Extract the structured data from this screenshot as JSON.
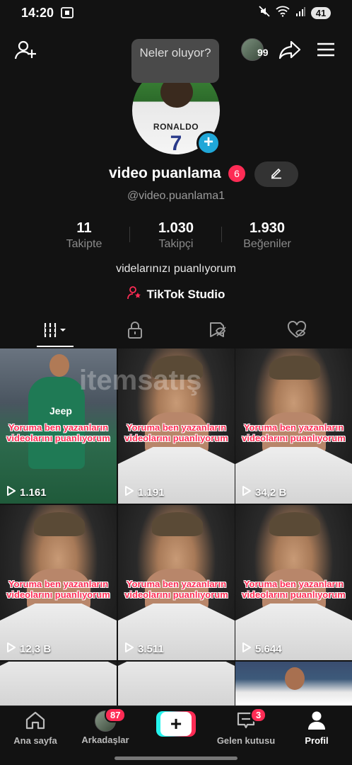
{
  "status_bar": {
    "time": "14:20",
    "battery": "41",
    "icons": [
      "screenshot-icon",
      "mute-icon",
      "wifi-icon",
      "signal-icon",
      "battery-icon"
    ]
  },
  "top_bar": {
    "tooltip": "Neler oluyor?",
    "friends_count": "99",
    "icons": [
      "add-user-icon",
      "share-icon",
      "menu-icon"
    ]
  },
  "profile": {
    "name": "video puanlama",
    "name_badge": "6",
    "handle": "@video.puanlama1",
    "avatar_jersey_text": "RONALDO",
    "avatar_jersey_number": "7",
    "bio": "videlarınızı puanlıyorum",
    "studio_label": "TikTok Studio"
  },
  "stats": [
    {
      "value": "11",
      "label": "Takipte"
    },
    {
      "value": "1.030",
      "label": "Takipçi"
    },
    {
      "value": "1.930",
      "label": "Beğeniler"
    }
  ],
  "tabs": [
    {
      "name": "videos",
      "icon": "grid-icon",
      "active": true
    },
    {
      "name": "private",
      "icon": "lock-icon",
      "active": false
    },
    {
      "name": "reposts",
      "icon": "repost-icon",
      "active": false
    },
    {
      "name": "liked",
      "icon": "liked-icon",
      "active": false
    }
  ],
  "watermark": "itemsatış",
  "videos": [
    {
      "style": "juve",
      "overlay": "Yoruma ben yazanların videolarını puanlıyorum",
      "views": "1.161"
    },
    {
      "style": "ronaldo",
      "overlay": "Yoruma ben yazanların videolarını puanlıyorum",
      "views": "1.191"
    },
    {
      "style": "ronaldo",
      "overlay": "Yoruma ben yazanların videolarını puanlıyorum",
      "views": "34,2 B"
    },
    {
      "style": "ronaldo",
      "overlay": "Yoruma ben yazanların videolarını puanlıyorum",
      "views": "12,3 B"
    },
    {
      "style": "ronaldo",
      "overlay": "Yoruma ben yazanların videolarını puanlıyorum",
      "views": "3.511"
    },
    {
      "style": "ronaldo",
      "overlay": "Yoruma ben yazanların videolarını puanlıyorum",
      "views": "5.644"
    },
    {
      "style": "ronaldo",
      "overlay": "",
      "views": ""
    },
    {
      "style": "ronaldo",
      "overlay": "",
      "views": ""
    },
    {
      "style": "real",
      "overlay": "",
      "views": ""
    }
  ],
  "bottom_nav": {
    "home": "Ana sayfa",
    "friends": "Arkadaşlar",
    "friends_badge": "87",
    "create": "+",
    "inbox": "Gelen kutusu",
    "inbox_badge": "3",
    "profile": "Profil"
  },
  "colors": {
    "background": "#121212",
    "accent_red": "#fe2c55",
    "accent_cyan": "#25f4ee",
    "plus_blue": "#20a7d8"
  }
}
